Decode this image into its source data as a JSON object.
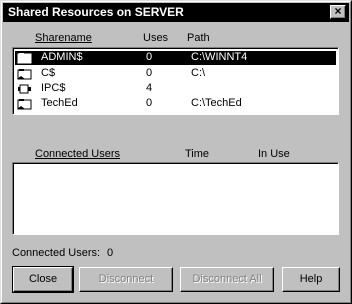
{
  "window": {
    "title": "Shared Resources on SERVER",
    "close_glyph": "×"
  },
  "share_list": {
    "headers": {
      "sharename": "Sharename",
      "uses": "Uses",
      "path": "Path"
    },
    "rows": [
      {
        "icon": "folder-share-icon",
        "name": "ADMIN$",
        "uses": "0",
        "path": "C:\\WINNT4",
        "selected": true
      },
      {
        "icon": "folder-share-icon",
        "name": "C$",
        "uses": "0",
        "path": "C:\\",
        "selected": false
      },
      {
        "icon": "pipe-icon",
        "name": "IPC$",
        "uses": "4",
        "path": "",
        "selected": false
      },
      {
        "icon": "folder-share-icon",
        "name": "TechEd",
        "uses": "0",
        "path": "C:\\TechEd",
        "selected": false
      }
    ]
  },
  "connected_list": {
    "headers": {
      "users": "Connected Users",
      "time": "Time",
      "in_use": "In Use"
    },
    "rows": []
  },
  "connected_count": {
    "label": "Connected Users:",
    "value": "0"
  },
  "buttons": {
    "close": "Close",
    "disconnect": "Disconnect",
    "disconnect_all": "Disconnect All",
    "help": "Help"
  }
}
